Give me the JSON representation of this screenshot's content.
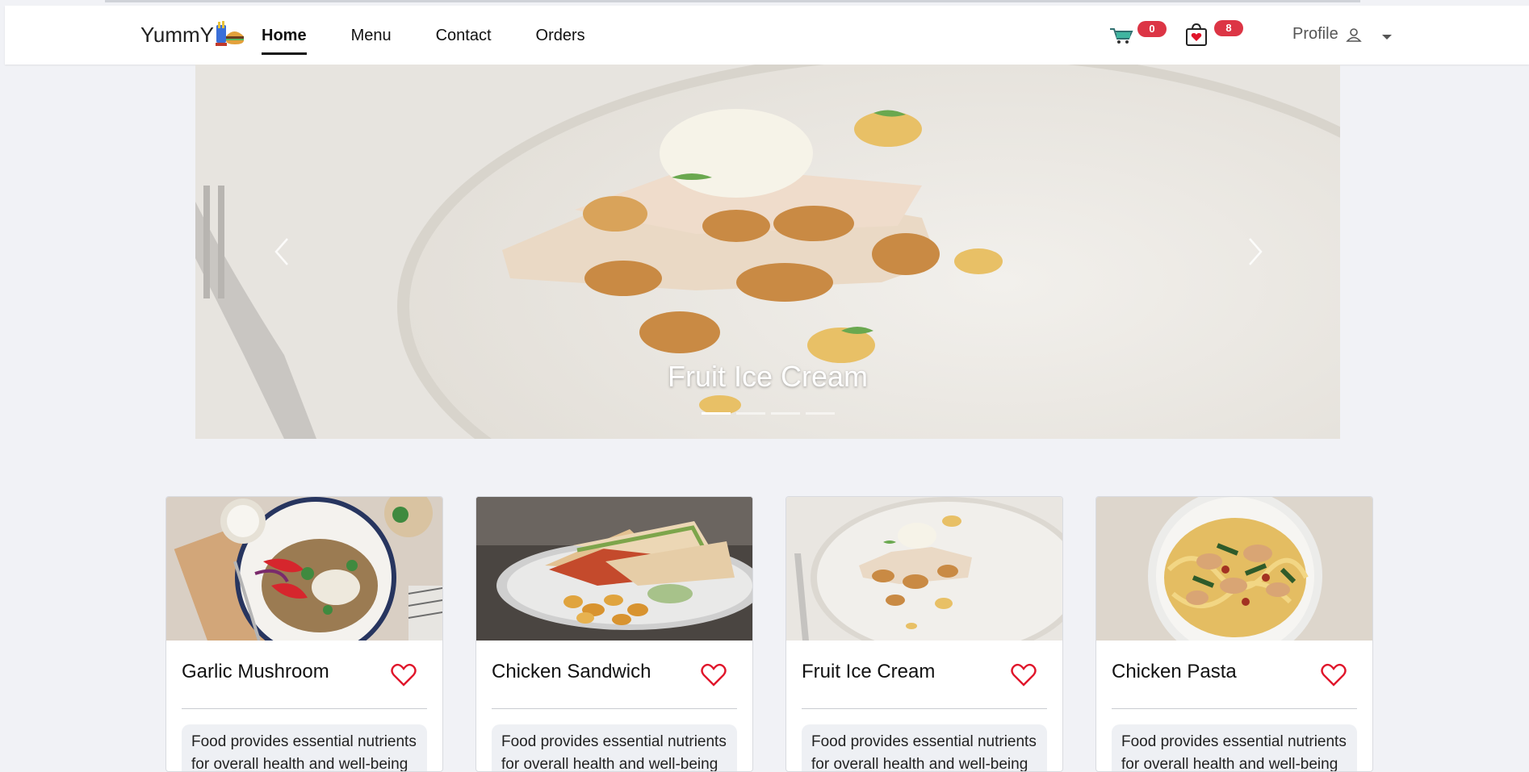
{
  "brand": {
    "name": "YummY"
  },
  "nav": {
    "links": [
      {
        "label": "Home",
        "active": true
      },
      {
        "label": "Menu",
        "active": false
      },
      {
        "label": "Contact",
        "active": false
      },
      {
        "label": "Orders",
        "active": false
      }
    ]
  },
  "header": {
    "cart_count": "0",
    "bag_count": "8",
    "profile_label": "Profile",
    "icons": [
      "cart-icon",
      "shopping-bag-icon",
      "user-icon",
      "caret-down-icon"
    ]
  },
  "carousel": {
    "caption": "Fruit Ice Cream",
    "slide_count": 4,
    "active_index": 0
  },
  "cards": [
    {
      "title": "Garlic Mushroom",
      "description": "Food provides essential nutrients for overall health and well-being"
    },
    {
      "title": "Chicken Sandwich",
      "description": "Food provides essential nutrients for overall health and well-being"
    },
    {
      "title": "Fruit Ice Cream",
      "description": "Food provides essential nutrients for overall health and well-being"
    },
    {
      "title": "Chicken Pasta",
      "description": "Food provides essential nutrients for overall health and well-being"
    }
  ],
  "colors": {
    "badge": "#dc3545",
    "heart": "#e0162b",
    "background": "#f1f2f6"
  }
}
